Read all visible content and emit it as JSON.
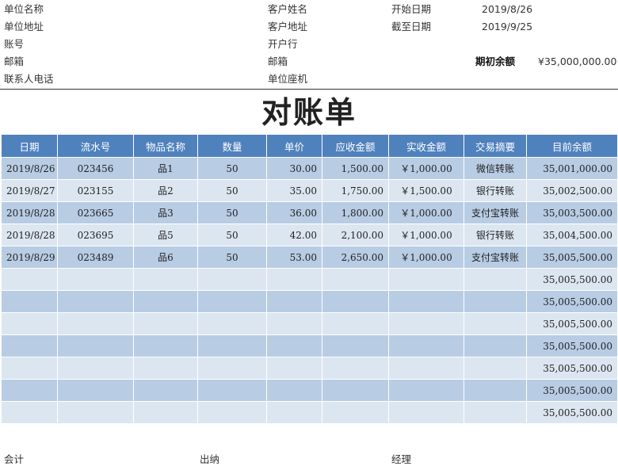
{
  "header": {
    "left": [
      "单位名称",
      "单位地址",
      "账号",
      "邮箱",
      "联系人电话"
    ],
    "middle": [
      "客户姓名",
      "客户地址",
      "开户行",
      "邮箱",
      "单位座机"
    ],
    "start_label": "开始日期",
    "start_value": "2019/8/26",
    "end_label": "截至日期",
    "end_value": "2019/9/25",
    "opening_label": "期初余额",
    "opening_value": "¥35,000,000.00"
  },
  "title": "对账单",
  "table": {
    "columns": [
      "日期",
      "流水号",
      "物品名称",
      "数量",
      "单价",
      "应收金额",
      "实收金额",
      "交易摘要",
      "目前余额"
    ],
    "rows": [
      [
        "2019/8/26",
        "023456",
        "品1",
        "50",
        "30.00",
        "1,500.00",
        "￥1,000.00",
        "微信转账",
        "35,001,000.00"
      ],
      [
        "2019/8/27",
        "023155",
        "品2",
        "50",
        "35.00",
        "1,750.00",
        "￥1,500.00",
        "银行转账",
        "35,002,500.00"
      ],
      [
        "2019/8/28",
        "023665",
        "品3",
        "50",
        "36.00",
        "1,800.00",
        "￥1,000.00",
        "支付宝转账",
        "35,003,500.00"
      ],
      [
        "2019/8/28",
        "023695",
        "品5",
        "50",
        "42.00",
        "2,100.00",
        "￥1,000.00",
        "银行转账",
        "35,004,500.00"
      ],
      [
        "2019/8/29",
        "023489",
        "品6",
        "50",
        "53.00",
        "2,650.00",
        "￥1,000.00",
        "支付宝转账",
        "35,005,500.00"
      ],
      [
        "",
        "",
        "",
        "",
        "",
        "",
        "",
        "",
        "35,005,500.00"
      ],
      [
        "",
        "",
        "",
        "",
        "",
        "",
        "",
        "",
        "35,005,500.00"
      ],
      [
        "",
        "",
        "",
        "",
        "",
        "",
        "",
        "",
        "35,005,500.00"
      ],
      [
        "",
        "",
        "",
        "",
        "",
        "",
        "",
        "",
        "35,005,500.00"
      ],
      [
        "",
        "",
        "",
        "",
        "",
        "",
        "",
        "",
        "35,005,500.00"
      ],
      [
        "",
        "",
        "",
        "",
        "",
        "",
        "",
        "",
        "35,005,500.00"
      ],
      [
        "",
        "",
        "",
        "",
        "",
        "",
        "",
        "",
        "35,005,500.00"
      ]
    ]
  },
  "footer": [
    "会计",
    "出纳",
    "经理"
  ]
}
